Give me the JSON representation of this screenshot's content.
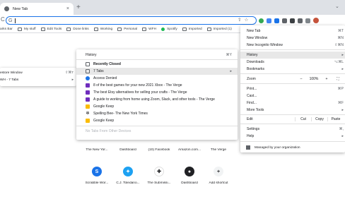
{
  "tab": {
    "title": "New Tab",
    "close": "×"
  },
  "tabstrip": {
    "new_tab": "+",
    "chevron": "⌄"
  },
  "toolbar": {
    "reload": "C",
    "omnibox_text": "G",
    "omni_icons": [
      "⇧",
      "☆"
    ]
  },
  "bookmarks": [
    "arks Bar",
    "My stuff",
    "Edit Tools",
    "Done links",
    "Working",
    "Personal",
    "WFH",
    "Spotify",
    "Imported",
    "Imported (1)"
  ],
  "left_menu": {
    "items": [
      {
        "label": "estore Window",
        "shortcut": "⇧⌘T"
      },
      {
        "label": "WH - 7 Tabs",
        "shortcut": "▸"
      }
    ]
  },
  "history_menu": {
    "header": {
      "label": "History",
      "shortcut": "⌘Y"
    },
    "recently_closed": "Recently Closed",
    "items": [
      {
        "label": "7 Tabs",
        "shortcut": "▸",
        "color": "#5f6368"
      },
      {
        "label": "Access Denied",
        "shortcut": "",
        "color": "#1a73e8"
      },
      {
        "label": "8 of the best games for your new 2021 Xbox - The Verge",
        "shortcut": "",
        "color": "#6f2dbd"
      },
      {
        "label": "The best Etsy alternatives for selling your crafts - The Verge",
        "shortcut": "",
        "color": "#6f2dbd"
      },
      {
        "label": "A guide to working from home using Zoom, Slack, and other tools - The Verge",
        "shortcut": "",
        "color": "#6f2dbd"
      },
      {
        "label": "Google Keep",
        "shortcut": "",
        "color": "#fbbc04"
      },
      {
        "label": "Spelling Bee- The New York Times",
        "shortcut": "",
        "color": "#202124"
      },
      {
        "label": "Google Keep",
        "shortcut": "",
        "color": "#fbbc04"
      }
    ],
    "other_devices": "No Tabs From Other Devices"
  },
  "main_menu": {
    "new_tab": {
      "label": "New Tab",
      "shortcut": "⌘T"
    },
    "new_window": {
      "label": "New Window",
      "shortcut": "⌘N"
    },
    "incognito": {
      "label": "New Incognito Window",
      "shortcut": "⇧⌘N"
    },
    "history": {
      "label": "History",
      "shortcut": "▸"
    },
    "downloads": {
      "label": "Downloads",
      "shortcut": "⌥⌘L"
    },
    "bookmarks": {
      "label": "Bookmarks",
      "shortcut": "▸"
    },
    "zoom": {
      "label": "Zoom",
      "minus": "–",
      "value": "100%",
      "plus": "+",
      "fullscreen": "⛶"
    },
    "print": {
      "label": "Print...",
      "shortcut": "⌘P"
    },
    "cast": {
      "label": "Cast..."
    },
    "find": {
      "label": "Find...",
      "shortcut": "⌘F"
    },
    "more_tools": {
      "label": "More Tools",
      "shortcut": "▸"
    },
    "edit": {
      "label": "Edit",
      "cut": "Cut",
      "copy": "Copy",
      "paste": "Paste"
    },
    "settings": {
      "label": "Settings",
      "shortcut": "⌘,"
    },
    "help": {
      "label": "Help",
      "shortcut": "▸"
    },
    "managed": "Managed by your organization"
  },
  "shortcuts": {
    "row1": [
      "The New Yor...",
      "Dashboard",
      "(10) Facebook",
      "Amazon.com...",
      "The Verge"
    ],
    "row2": [
      {
        "label": "Scrabble Wor...",
        "glyph": "S",
        "color": "#1a73e8"
      },
      {
        "label": "C.J. Toledano...",
        "glyph": "✦",
        "color": "#1da1f2"
      },
      {
        "label": "The Submissi...",
        "glyph": "✚",
        "color": "#202124"
      },
      {
        "label": "Dashboard",
        "glyph": "●",
        "color": "#202124"
      },
      {
        "label": "Add shortcut",
        "glyph": "+",
        "color": "#f1f3f4"
      }
    ]
  }
}
